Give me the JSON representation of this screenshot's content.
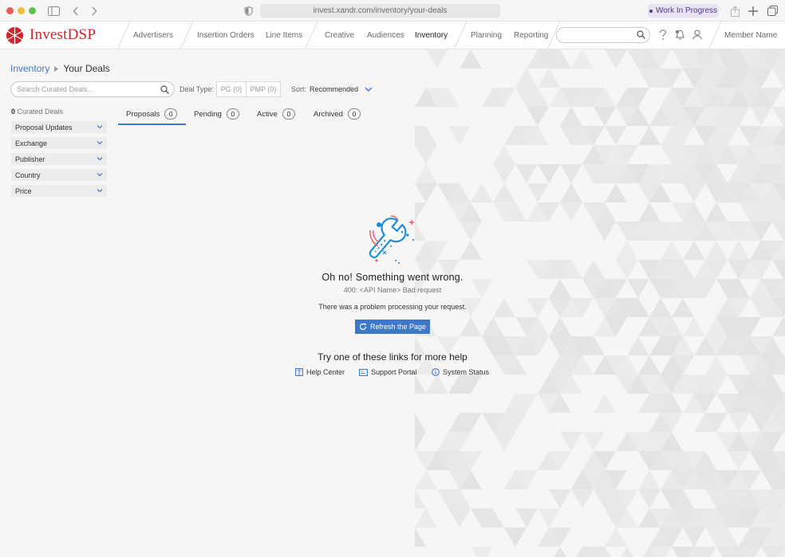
{
  "browser": {
    "url": "invest.xandr.com/inventory/your-deals",
    "work_label": "Work In Progress"
  },
  "brand": {
    "name": "InvestDSP",
    "color": "#d2232a",
    "accent": "#3f78c8"
  },
  "nav": {
    "items": [
      {
        "label": "Advertisers"
      },
      {
        "label": "Insertion Orders"
      },
      {
        "label": "Line Items"
      },
      {
        "label": "Creative"
      },
      {
        "label": "Audiences"
      },
      {
        "label": "Inventory"
      },
      {
        "label": "Planning"
      },
      {
        "label": "Reporting"
      }
    ],
    "member": "Member Name"
  },
  "breadcrumb": {
    "parent": "Inventory",
    "current": "Your Deals"
  },
  "toolbar": {
    "search_placeholder": "Search Curated Deals...",
    "deal_type_label": "Deal Type:",
    "pg": "PG (0)",
    "pmp": "PMP (0)",
    "sort_label": "Sort:",
    "sort_value": "Recommended"
  },
  "sidebar": {
    "count_num": "0",
    "count_label": "Curated Deals",
    "filters": [
      {
        "label": "Proposal Updates"
      },
      {
        "label": "Exchange"
      },
      {
        "label": "Publisher"
      },
      {
        "label": "Country"
      },
      {
        "label": "Price"
      }
    ]
  },
  "tabs": [
    {
      "label": "Proposals",
      "count": "0"
    },
    {
      "label": "Pending",
      "count": "0"
    },
    {
      "label": "Active",
      "count": "0"
    },
    {
      "label": "Archived",
      "count": "0"
    }
  ],
  "error": {
    "title": "Oh no! Something went wrong.",
    "code": "400: <API Name> Bad request",
    "message": "There was a problem processing your request.",
    "refresh_label": "Refresh the Page",
    "help_title": "Try one of these links for more help",
    "links": [
      {
        "label": "Help Center",
        "icon": "book-icon"
      },
      {
        "label": "Support Portal",
        "icon": "support-icon"
      },
      {
        "label": "System Status",
        "icon": "info-icon"
      }
    ]
  }
}
